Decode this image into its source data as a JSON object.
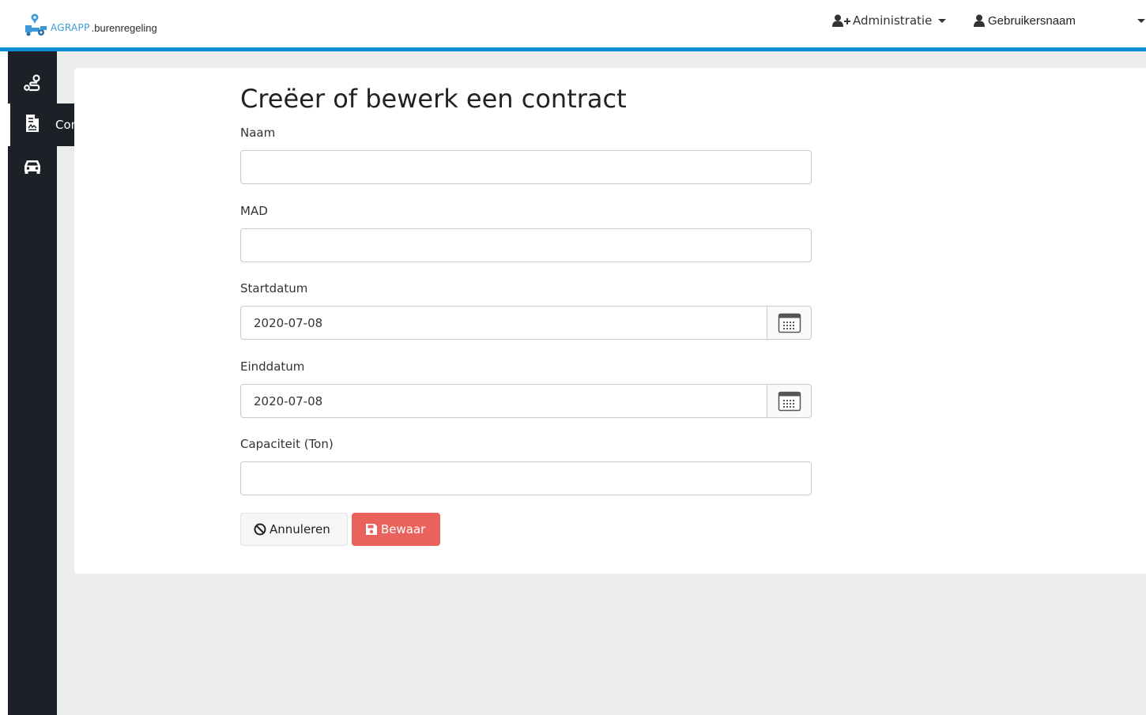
{
  "header": {
    "logo_word": "AGRAPP",
    "logo_sub": ".burenregeling",
    "admin_label": "Administratie",
    "user_label": "Gebruikersnaam"
  },
  "sidebar": {
    "items": [
      {
        "icon": "route-icon"
      },
      {
        "icon": "contract-file-icon",
        "label": "Contract",
        "active": true
      },
      {
        "icon": "car-icon"
      }
    ]
  },
  "form": {
    "title": "Creëer of bewerk een contract",
    "fields": {
      "naam": {
        "label": "Naam",
        "value": ""
      },
      "mad": {
        "label": "MAD",
        "value": ""
      },
      "startdatum": {
        "label": "Startdatum",
        "value": "2020-07-08"
      },
      "einddatum": {
        "label": "Einddatum",
        "value": "2020-07-08"
      },
      "capaciteit": {
        "label": "Capaciteit (Ton)",
        "value": ""
      }
    },
    "cancel_label": "Annuleren",
    "save_label": "Bewaar"
  },
  "colors": {
    "accent": "#0a8fd6",
    "sidebar": "#1b2126",
    "save": "#e9635c",
    "background": "#ececec"
  }
}
